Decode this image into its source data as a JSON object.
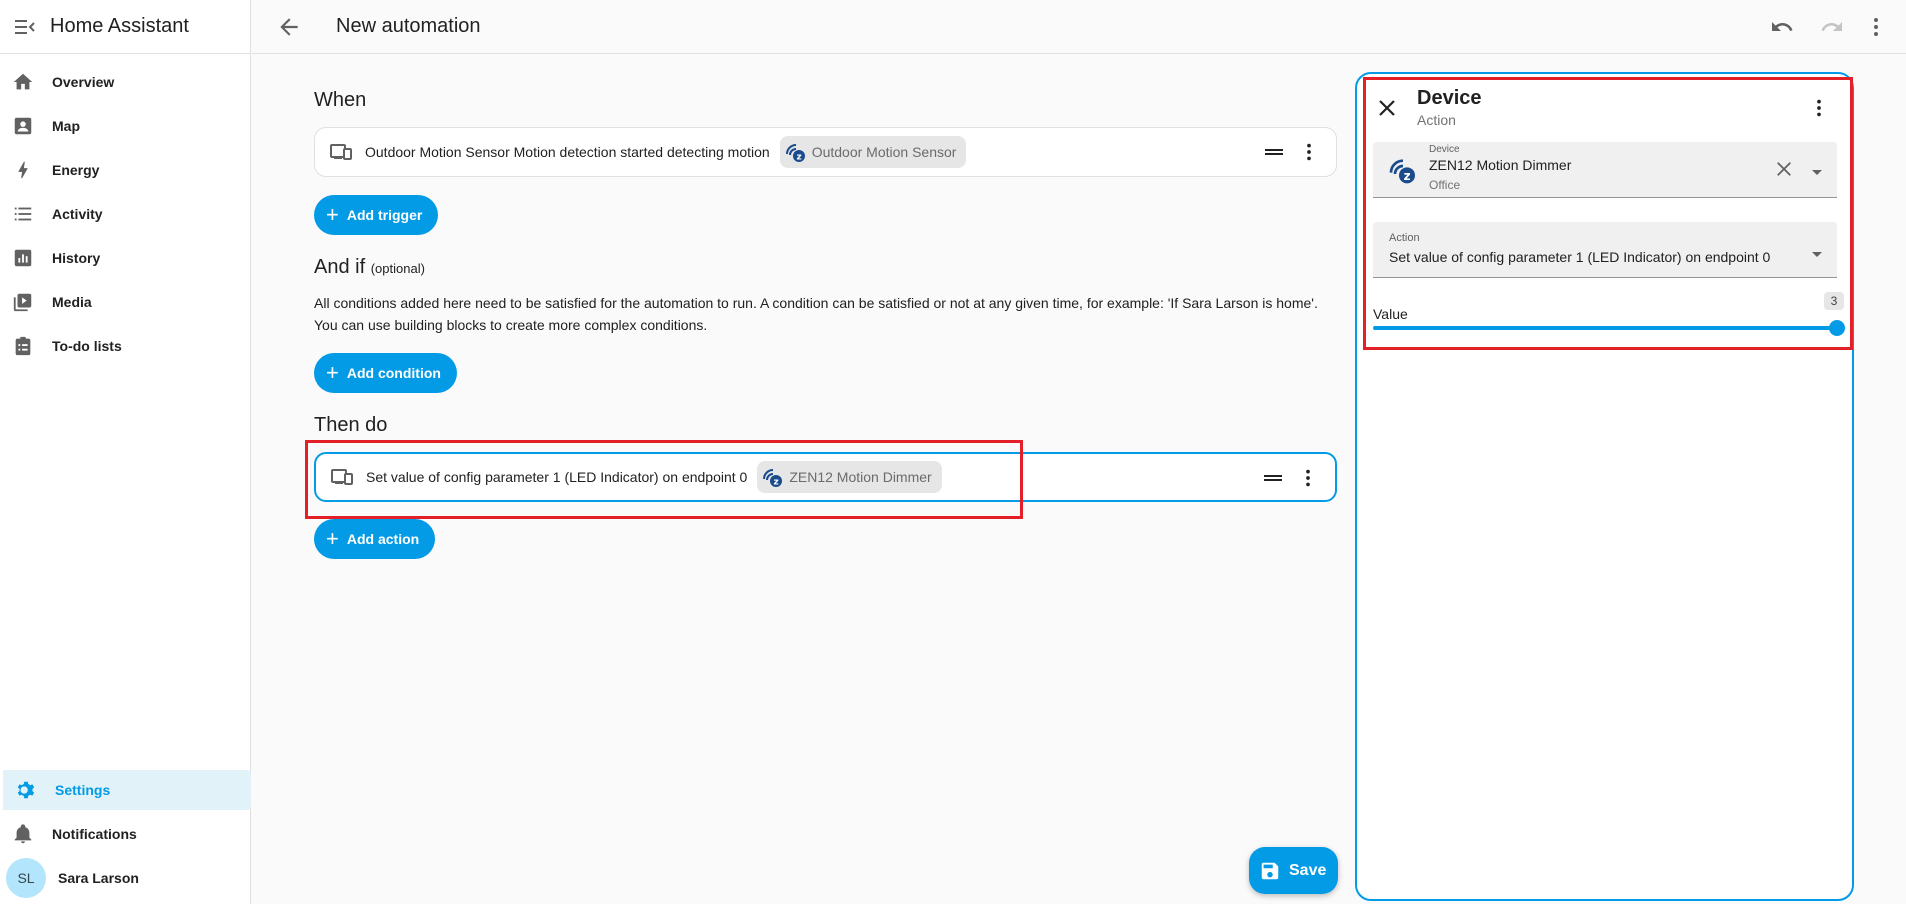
{
  "app": {
    "title": "Home Assistant"
  },
  "sidebar": {
    "items": [
      {
        "label": "Overview",
        "icon": "home-icon"
      },
      {
        "label": "Map",
        "icon": "map-icon"
      },
      {
        "label": "Energy",
        "icon": "lightning-icon"
      },
      {
        "label": "Activity",
        "icon": "list-icon"
      },
      {
        "label": "History",
        "icon": "chart-icon"
      },
      {
        "label": "Media",
        "icon": "media-icon"
      },
      {
        "label": "To-do lists",
        "icon": "clipboard-icon"
      }
    ],
    "bottom": [
      {
        "label": "Settings",
        "icon": "gear-icon",
        "active": true
      },
      {
        "label": "Notifications",
        "icon": "bell-icon"
      }
    ],
    "user": {
      "initials": "SL",
      "name": "Sara Larson"
    }
  },
  "topbar": {
    "title": "New automation"
  },
  "editor": {
    "when": {
      "title": "When",
      "trigger_text": "Outdoor Motion Sensor Motion detection started detecting motion",
      "trigger_chip": "Outdoor Motion Sensor",
      "add_button": "Add trigger"
    },
    "and_if": {
      "title": "And if",
      "optional": "(optional)",
      "description_line1": "All conditions added here need to be satisfied for the automation to run. A condition can be satisfied or not at any given time, for example: 'If Sara Larson is home'.",
      "description_line2": "You can use building blocks to create more complex conditions.",
      "add_button": "Add condition"
    },
    "then_do": {
      "title": "Then do",
      "action_text": "Set value of config parameter 1 (LED Indicator) on endpoint 0",
      "action_chip": "ZEN12 Motion Dimmer",
      "add_button": "Add action"
    },
    "save_label": "Save"
  },
  "panel": {
    "title": "Device",
    "subtitle": "Action",
    "device_field": {
      "label": "Device",
      "value": "ZEN12 Motion Dimmer",
      "area": "Office"
    },
    "action_field": {
      "label": "Action",
      "value": "Set value of config parameter 1 (LED Indicator) on endpoint 0"
    },
    "value_slider": {
      "label": "Value",
      "value": "3"
    }
  },
  "colors": {
    "accent": "#039be5",
    "highlight": "#e32028"
  }
}
